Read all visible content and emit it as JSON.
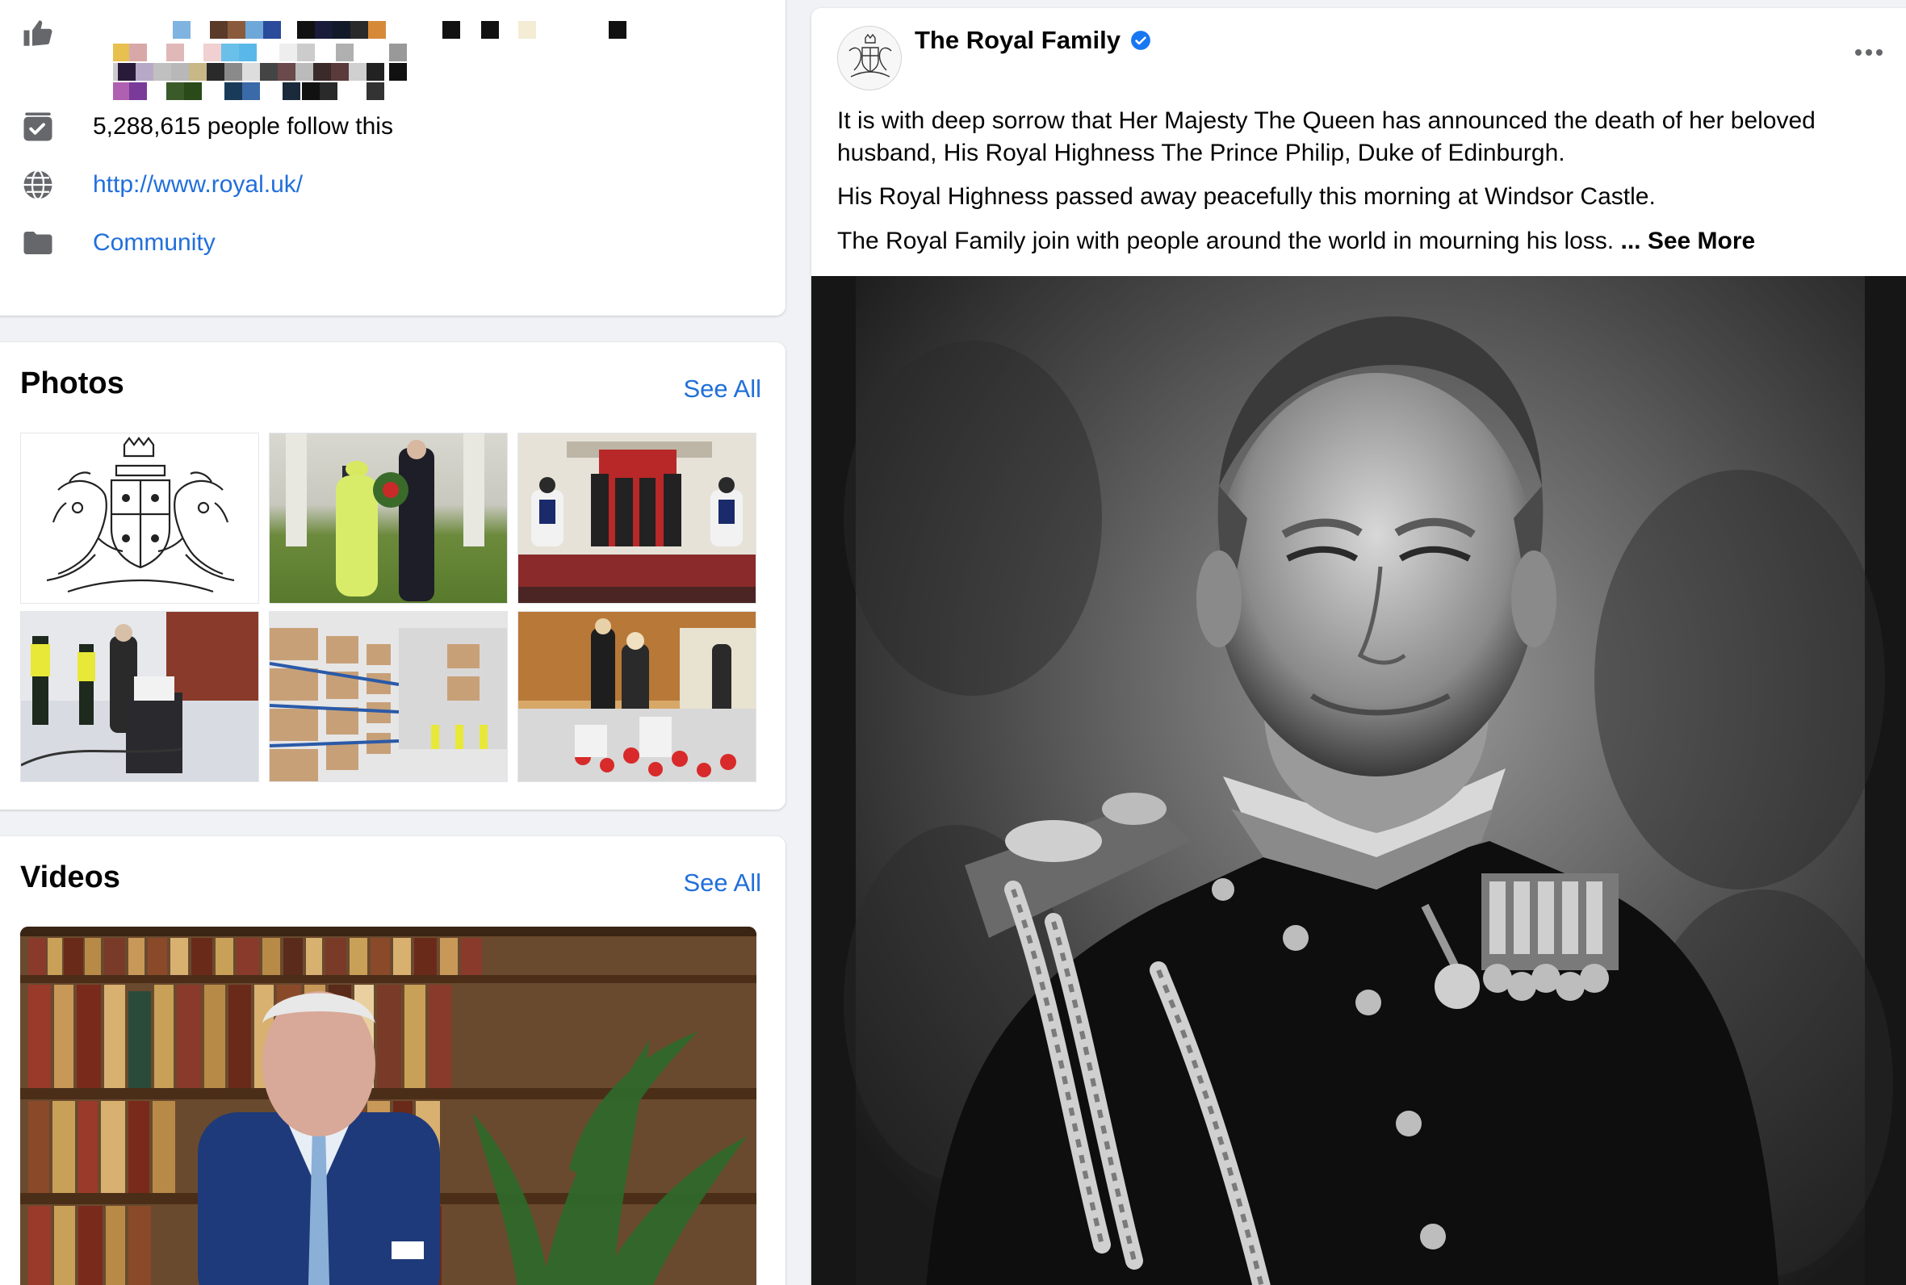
{
  "about": {
    "followers_text": "5,288,615 people follow this",
    "website": "http://www.royal.uk/",
    "category": "Community"
  },
  "photos": {
    "title": "Photos",
    "see_all": "See All"
  },
  "videos": {
    "title": "Videos",
    "see_all": "See All"
  },
  "post": {
    "page_name": "The Royal Family",
    "paragraph_1": "It is with deep sorrow that Her Majesty The Queen has announced the death of her beloved husband, His Royal Highness The Prince Philip, Duke of Edinburgh.",
    "paragraph_2": "His Royal Highness passed away peacefully this morning at Windsor Castle.",
    "paragraph_3": "The Royal Family join with people around the world in mourning his loss. ",
    "see_more": "... See More"
  },
  "colors": {
    "link": "#216fdb",
    "verified": "#1877f2",
    "background": "#f0f2f5",
    "icon_gray": "#65676b"
  },
  "icons": [
    "like-icon",
    "follow-icon",
    "globe-icon",
    "folder-icon",
    "verified-icon",
    "more-icon"
  ]
}
